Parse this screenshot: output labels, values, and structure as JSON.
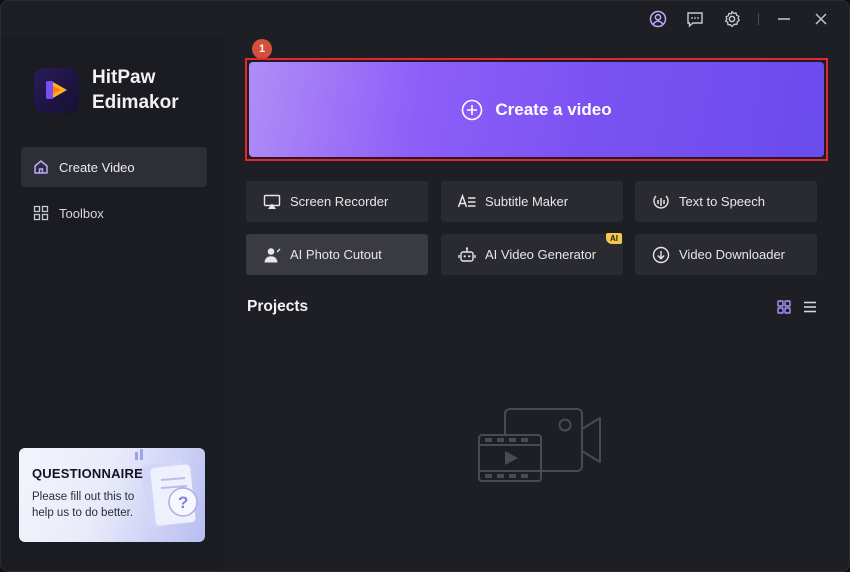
{
  "app": {
    "brand_line1": "HitPaw",
    "brand_line2": "Edimakor"
  },
  "titlebar": {
    "icons": [
      "account-icon",
      "feedback-icon",
      "settings-icon",
      "minimize-icon",
      "close-icon"
    ]
  },
  "sidebar": {
    "items": [
      {
        "label": "Create Video",
        "icon": "home-icon",
        "active": true
      },
      {
        "label": "Toolbox",
        "icon": "grid-icon",
        "active": false
      }
    ],
    "questionnaire": {
      "title": "QUESTIONNAIRE",
      "text": "Please fill out this to help us to do better."
    }
  },
  "main": {
    "create": {
      "label": "Create a video",
      "badge": "1",
      "highlight_color": "#e3262f"
    },
    "tools": [
      {
        "label": "Screen Recorder",
        "icon": "screen-recorder-icon"
      },
      {
        "label": "Subtitle Maker",
        "icon": "subtitle-icon"
      },
      {
        "label": "Text to Speech",
        "icon": "text-to-speech-icon"
      },
      {
        "label": "AI Photo Cutout",
        "icon": "person-cutout-icon",
        "selected": true
      },
      {
        "label": "AI Video Generator",
        "icon": "robot-icon",
        "tag": "AI"
      },
      {
        "label": "Video Downloader",
        "icon": "download-icon"
      }
    ],
    "projects": {
      "title": "Projects",
      "view_modes": [
        "grid-view-icon",
        "list-view-icon"
      ],
      "active_view": "grid"
    }
  },
  "colors": {
    "accent": "#7a52f2",
    "background": "#1e1f25",
    "sidebar": "#1b1c21",
    "tool_button": "#2a2b31"
  }
}
